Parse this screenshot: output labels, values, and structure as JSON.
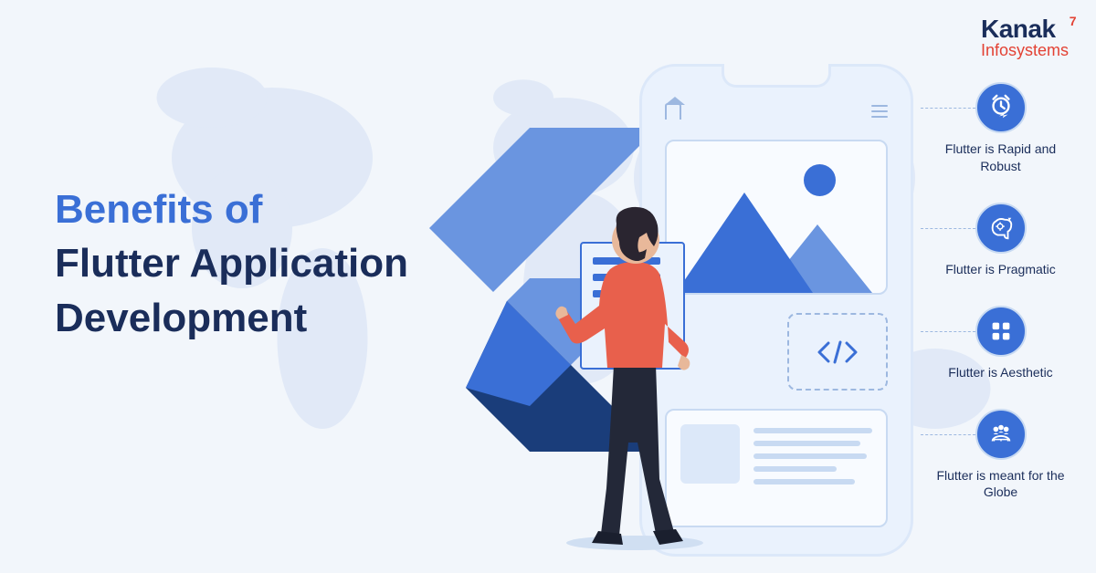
{
  "logo": {
    "line1": "Kanak",
    "line2": "Infosystems"
  },
  "headline": {
    "line1": "Benefits of",
    "line2": "Flutter Application",
    "line3": "Development"
  },
  "benefits": [
    {
      "label": "Flutter is Rapid and Robust",
      "icon": "clock-fast"
    },
    {
      "label": "Flutter is Pragmatic",
      "icon": "brain"
    },
    {
      "label": "Flutter is Aesthetic",
      "icon": "grid"
    },
    {
      "label": "Flutter is meant for the Globe",
      "icon": "globe-team"
    }
  ]
}
